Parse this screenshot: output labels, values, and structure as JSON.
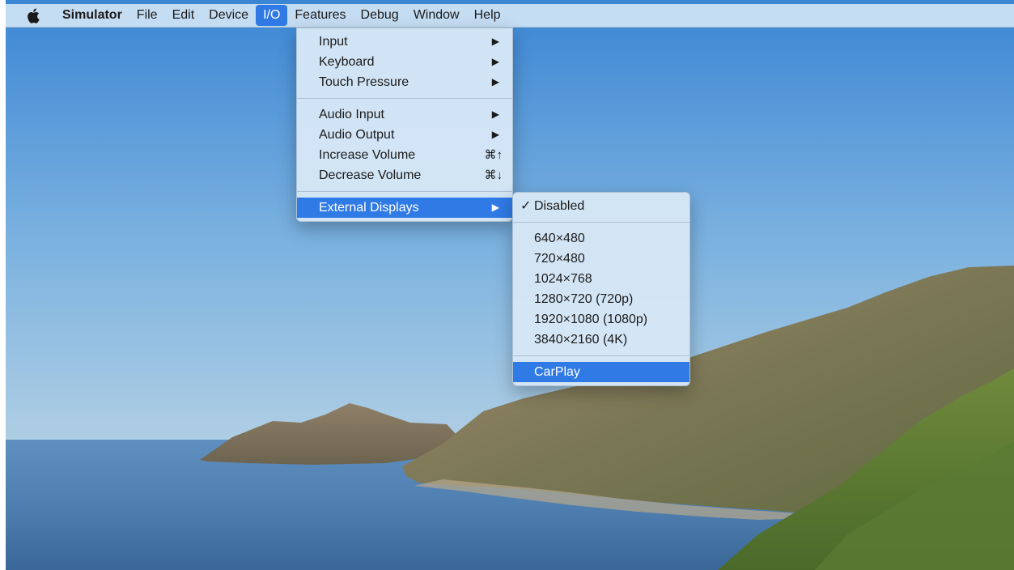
{
  "menubar": {
    "apple_icon": "apple-logo-icon",
    "items": [
      {
        "label": "Simulator"
      },
      {
        "label": "File"
      },
      {
        "label": "Edit"
      },
      {
        "label": "Device"
      },
      {
        "label": "I/O"
      },
      {
        "label": "Features"
      },
      {
        "label": "Debug"
      },
      {
        "label": "Window"
      },
      {
        "label": "Help"
      }
    ]
  },
  "io_menu": {
    "input": {
      "label": "Input",
      "arrow": "▶"
    },
    "keyboard": {
      "label": "Keyboard",
      "arrow": "▶"
    },
    "touch_pressure": {
      "label": "Touch Pressure",
      "arrow": "▶"
    },
    "audio_input": {
      "label": "Audio Input",
      "arrow": "▶"
    },
    "audio_output": {
      "label": "Audio Output",
      "arrow": "▶"
    },
    "increase_volume": {
      "label": "Increase Volume",
      "shortcut": "⌘↑"
    },
    "decrease_volume": {
      "label": "Decrease Volume",
      "shortcut": "⌘↓"
    },
    "external_displays": {
      "label": "External Displays",
      "arrow": "▶"
    }
  },
  "external_displays_submenu": {
    "check_mark": "✓",
    "disabled": {
      "label": "Disabled",
      "checked": true
    },
    "resolutions": [
      {
        "label": "640×480"
      },
      {
        "label": "720×480"
      },
      {
        "label": "1024×768"
      },
      {
        "label": "1280×720 (720p)"
      },
      {
        "label": "1920×1080 (1080p)"
      },
      {
        "label": "3840×2160 (4K)"
      }
    ],
    "carplay": {
      "label": "CarPlay"
    }
  },
  "colors": {
    "highlight": "#2f7ae5",
    "menubar_bg": "#d0e4f5",
    "menu_bg": "#d6e7f6"
  }
}
